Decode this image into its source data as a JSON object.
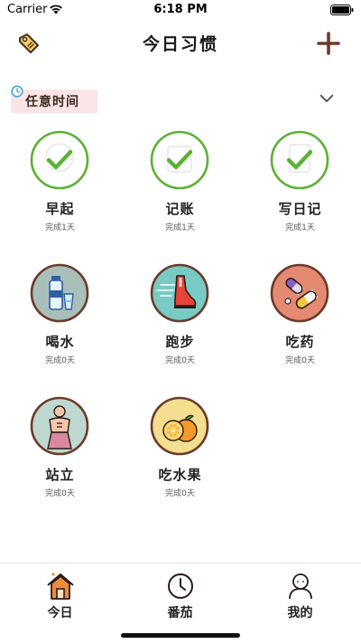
{
  "status_bar": {
    "carrier": "Carrier",
    "time": "6:18 PM",
    "wifi_icon": "wifi-icon",
    "battery_icon": "battery-icon"
  },
  "nav": {
    "title": "今日习惯",
    "left_icon": "tag-icon",
    "right_icon": "add-icon"
  },
  "section": {
    "label": "任意时间",
    "icon": "clock-icon",
    "toggle_icon": "chevron-down-icon"
  },
  "habits": [
    {
      "name": "早起",
      "status": "完成1天",
      "done": true,
      "icon": "check-icon"
    },
    {
      "name": "记账",
      "status": "完成1天",
      "done": true,
      "icon": "check-icon"
    },
    {
      "name": "写日记",
      "status": "完成1天",
      "done": true,
      "icon": "check-icon"
    },
    {
      "name": "喝水",
      "status": "完成0天",
      "done": false,
      "icon": "water-bottle-icon"
    },
    {
      "name": "跑步",
      "status": "完成0天",
      "done": false,
      "icon": "running-shoe-icon"
    },
    {
      "name": "吃药",
      "status": "完成0天",
      "done": false,
      "icon": "pills-icon"
    },
    {
      "name": "站立",
      "status": "完成0天",
      "done": false,
      "icon": "standing-figure-icon"
    },
    {
      "name": "吃水果",
      "status": "完成0天",
      "done": false,
      "icon": "orange-fruit-icon"
    }
  ],
  "tabs": [
    {
      "label": "今日",
      "icon": "home-icon",
      "active": true
    },
    {
      "label": "番茄",
      "icon": "timer-clock-icon",
      "active": false
    },
    {
      "label": "我的",
      "icon": "person-icon",
      "active": false
    }
  ],
  "colors": {
    "check_green": "#5cb135",
    "badge_brown": "#6b3b2a",
    "banner_pink": "#fbe4e6",
    "accent_orange": "#f08a3c"
  }
}
